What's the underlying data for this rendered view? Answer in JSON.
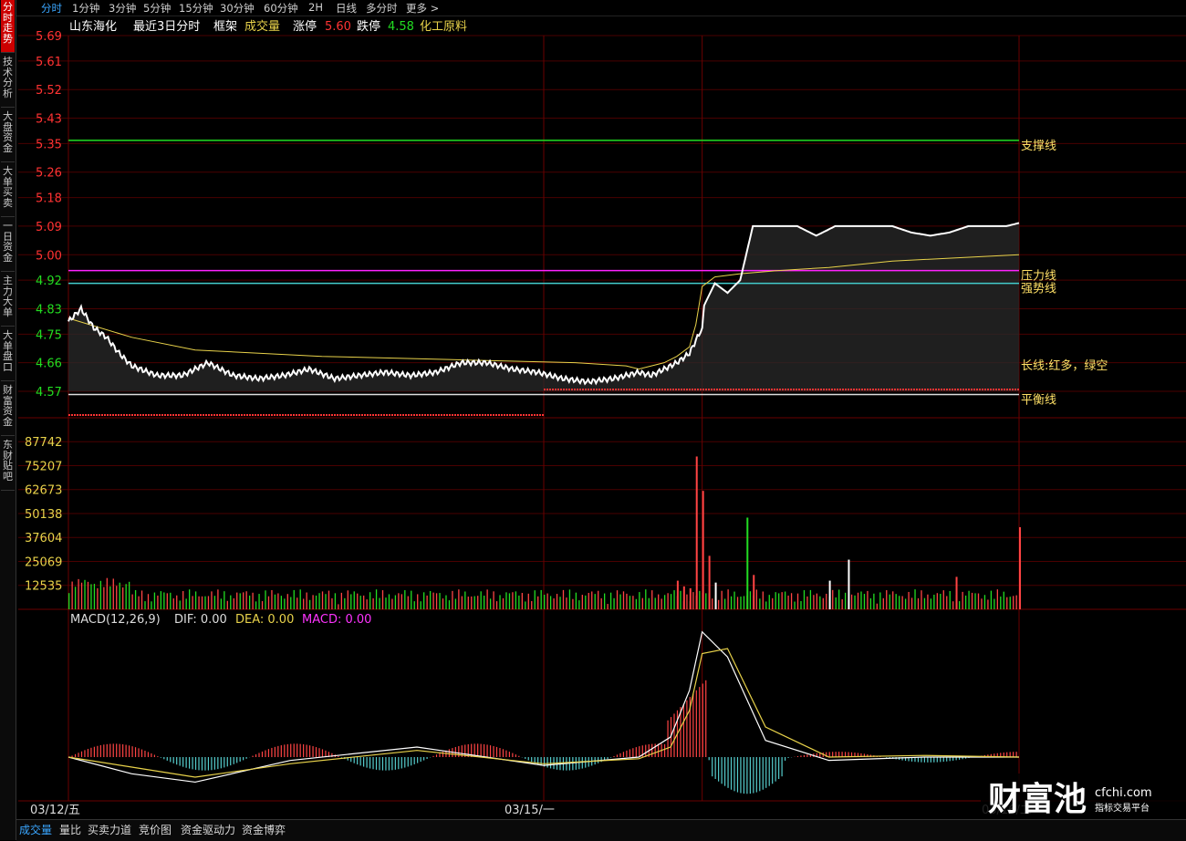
{
  "sidebar": {
    "tabs": [
      {
        "label": "分时走势",
        "active": true
      },
      {
        "label": "技术分析",
        "active": false
      },
      {
        "label": "大盘资金",
        "active": false
      },
      {
        "label": "大单买卖",
        "active": false
      },
      {
        "label": "一日资金",
        "active": false
      },
      {
        "label": "主力大单",
        "active": false
      },
      {
        "label": "大单盘口",
        "active": false
      },
      {
        "label": "财富资金",
        "active": false
      },
      {
        "label": "东财贴吧",
        "active": false
      }
    ]
  },
  "period_tabs": [
    {
      "label": "分时",
      "active": true
    },
    {
      "label": "1分钟"
    },
    {
      "label": "3分钟"
    },
    {
      "label": "5分钟"
    },
    {
      "label": "15分钟"
    },
    {
      "label": "30分钟"
    },
    {
      "label": "60分钟"
    },
    {
      "label": "2H"
    },
    {
      "label": "日线"
    },
    {
      "label": "多分时"
    },
    {
      "label": "更多 >"
    }
  ],
  "chart_header": {
    "stock_name": "山东海化",
    "mode": "最近3日分时",
    "frame": "框架",
    "volume_label": "成交量",
    "limit_up_label": "涨停",
    "limit_up_value": "5.60",
    "limit_down_label": "跌停",
    "limit_down_value": "4.58",
    "sector": "化工原料"
  },
  "chart_data": [
    {
      "type": "line",
      "price_ticks": [
        "5.69",
        "5.61",
        "5.52",
        "5.43",
        "5.35",
        "5.26",
        "5.18",
        "5.09",
        "5.00",
        "4.92",
        "4.83",
        "4.75",
        "4.66",
        "4.57"
      ],
      "ylim": [
        4.57,
        5.69
      ],
      "x_labels": [
        "03/12/五",
        "03/15/一",
        "03/16/二"
      ],
      "series": [
        {
          "name": "价格",
          "x": [
            0,
            2,
            4,
            6,
            8,
            10,
            14,
            18,
            22,
            26,
            30,
            34,
            38,
            42,
            46,
            50,
            54,
            58,
            62,
            66,
            70,
            74,
            78,
            82,
            86,
            90,
            92,
            94,
            96,
            98,
            100,
            100.3,
            102,
            104,
            106,
            108,
            110,
            112,
            115,
            118,
            121,
            124,
            127,
            130,
            133,
            136,
            139,
            142,
            145,
            148,
            150
          ],
          "y": [
            4.79,
            4.83,
            4.77,
            4.74,
            4.69,
            4.65,
            4.62,
            4.62,
            4.66,
            4.62,
            4.61,
            4.62,
            4.64,
            4.61,
            4.62,
            4.63,
            4.62,
            4.63,
            4.66,
            4.66,
            4.64,
            4.63,
            4.61,
            4.6,
            4.61,
            4.63,
            4.62,
            4.64,
            4.66,
            4.69,
            4.77,
            4.84,
            4.91,
            4.88,
            4.92,
            5.09,
            5.09,
            5.09,
            5.09,
            5.06,
            5.09,
            5.09,
            5.09,
            5.09,
            5.07,
            5.06,
            5.07,
            5.09,
            5.09,
            5.09,
            5.1
          ]
        },
        {
          "name": "均价",
          "x": [
            0,
            10,
            20,
            40,
            60,
            80,
            88,
            90,
            92,
            94,
            96,
            98,
            99,
            100,
            102,
            106,
            112,
            120,
            130,
            140,
            150
          ],
          "y": [
            4.8,
            4.74,
            4.7,
            4.68,
            4.67,
            4.66,
            4.65,
            4.64,
            4.65,
            4.66,
            4.68,
            4.71,
            4.78,
            4.9,
            4.93,
            4.94,
            4.95,
            4.96,
            4.98,
            4.99,
            5.0
          ]
        }
      ],
      "reference_lines": [
        {
          "name": "支撑线",
          "value": 5.36,
          "color": "#22dd22"
        },
        {
          "name": "压力线",
          "value": 4.95,
          "color": "#ff22ff"
        },
        {
          "name": "强势线",
          "value": 4.91,
          "color": "#44cccc"
        },
        {
          "name": "平衡线",
          "value": 4.56,
          "color": "#dddddd"
        }
      ],
      "trend_label": "长线:红多，绿空"
    },
    {
      "type": "bar",
      "volume_ticks": [
        "87742",
        "75207",
        "62673",
        "50138",
        "37604",
        "25069",
        "12535"
      ],
      "ylim": [
        0,
        100276
      ],
      "spikes": [
        {
          "x": 96,
          "value": 15000,
          "color": "#ff4444"
        },
        {
          "x": 97,
          "value": 12000,
          "color": "#ff4444"
        },
        {
          "x": 98,
          "value": 11000,
          "color": "#ff4444"
        },
        {
          "x": 99,
          "value": 80000,
          "color": "#ff4444"
        },
        {
          "x": 100,
          "value": 62000,
          "color": "#ff4444"
        },
        {
          "x": 101,
          "value": 28000,
          "color": "#ff4444"
        },
        {
          "x": 102,
          "value": 14000,
          "color": "#ffffff"
        },
        {
          "x": 107,
          "value": 48000,
          "color": "#22dd22"
        },
        {
          "x": 108,
          "value": 18000,
          "color": "#ff4444"
        },
        {
          "x": 120,
          "value": 15000,
          "color": "#ffffff"
        },
        {
          "x": 123,
          "value": 26000,
          "color": "#ffffff"
        },
        {
          "x": 140,
          "value": 17000,
          "color": "#ff4444"
        },
        {
          "x": 150,
          "value": 43000,
          "color": "#ff4444"
        }
      ]
    },
    {
      "type": "line",
      "indicator": "MACD(12,26,9)",
      "series": [
        {
          "name": "DIF",
          "values_at": {
            "x": [
              0,
              10,
              20,
              35,
              55,
              75,
              90,
              95,
              98,
              100,
              104,
              110,
              120,
              135,
              150
            ],
            "y": [
              0.0,
              -0.01,
              -0.015,
              -0.002,
              0.006,
              -0.005,
              0.0,
              0.012,
              0.04,
              0.075,
              0.06,
              0.01,
              -0.002,
              0.0,
              0.0
            ]
          }
        },
        {
          "name": "DEA",
          "values_at": {
            "x": [
              0,
              10,
              20,
              35,
              55,
              75,
              90,
              95,
              98,
              100,
              104,
              110,
              120,
              135,
              150
            ],
            "y": [
              0.0,
              -0.006,
              -0.012,
              -0.004,
              0.004,
              -0.004,
              -0.001,
              0.006,
              0.028,
              0.062,
              0.065,
              0.018,
              0.0,
              0.001,
              0.0
            ]
          }
        }
      ],
      "header": {
        "dif_label": "DIF: 0.00",
        "dea_label": "DEA: 0.00",
        "macd_label": "MACD: 0.00"
      }
    }
  ],
  "watermark": {
    "brand": "财富池",
    "site": "cfchi.com",
    "tagline": "指标交易平台"
  },
  "bottom_tabs": [
    {
      "label": "成交量",
      "active": true
    },
    {
      "label": "量比"
    },
    {
      "label": "买卖力道"
    },
    {
      "label": "竞价图"
    },
    {
      "label": "资金驱动力"
    },
    {
      "label": "资金博弈"
    }
  ],
  "colors": {
    "up": "#ff3333",
    "down": "#22dd22",
    "grid": "#4a0000",
    "label_yellow": "#e8d24a",
    "price_line": "#ffffff",
    "avg_line": "#e8d24a"
  }
}
